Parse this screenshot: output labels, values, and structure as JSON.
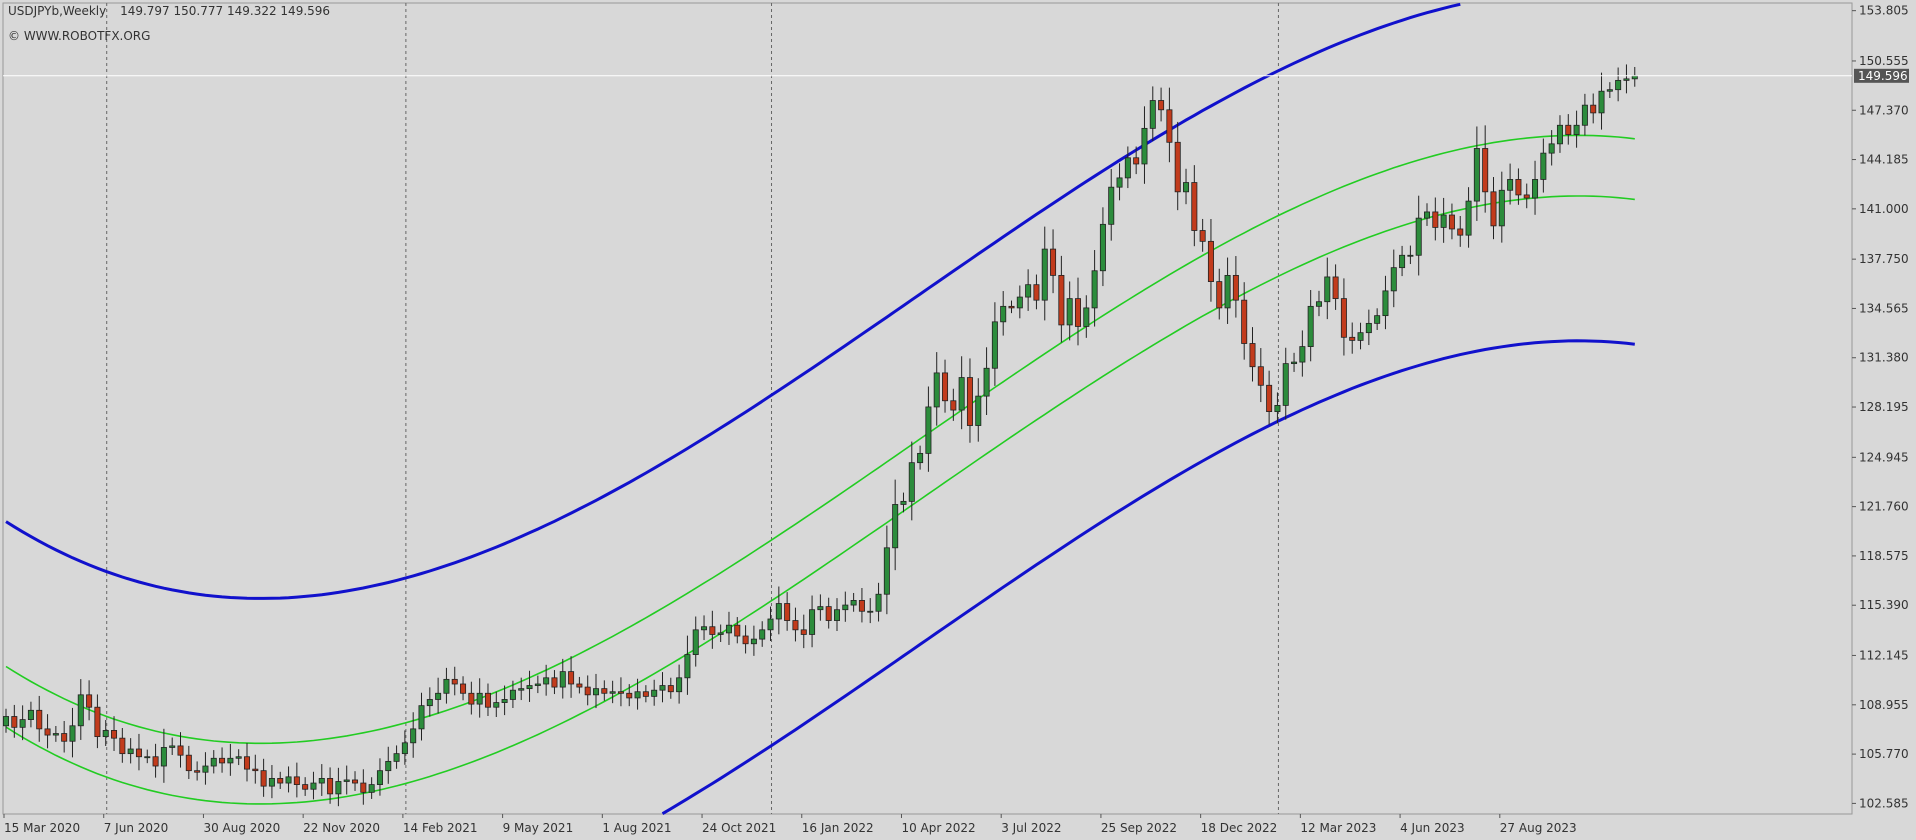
{
  "header": {
    "symbol": "USDJPYb,Weekly",
    "open": "149.797",
    "high": "150.777",
    "low": "149.322",
    "close": "149.596"
  },
  "credit": "© WWW.ROBOTFX.ORG",
  "current_price_label": "149.596",
  "chart_data": {
    "type": "candlestick",
    "timeframe": "Weekly",
    "x_labels": [
      "15 Mar 2020",
      "7 Jun 2020",
      "30 Aug 2020",
      "22 Nov 2020",
      "14 Feb 2021",
      "9 May 2021",
      "1 Aug 2021",
      "24 Oct 2021",
      "16 Jan 2022",
      "10 Apr 2022",
      "3 Jul 2022",
      "25 Sep 2022",
      "18 Dec 2022",
      "12 Mar 2023",
      "4 Jun 2023",
      "27 Aug 2023"
    ],
    "y_ticks": [
      "153.805",
      "150.555",
      "147.370",
      "144.185",
      "141.000",
      "137.750",
      "134.565",
      "131.380",
      "128.195",
      "124.945",
      "121.760",
      "118.575",
      "115.390",
      "112.145",
      "108.955",
      "105.770",
      "102.585"
    ],
    "ylim": [
      101.9,
      154.3
    ],
    "current_price": 149.596,
    "separator_after_weeks": [
      12,
      48,
      92,
      153
    ],
    "closes": [
      108.2,
      107.5,
      108.0,
      108.6,
      107.4,
      107.0,
      107.1,
      106.6,
      107.6,
      109.6,
      108.8,
      106.9,
      107.3,
      106.8,
      105.8,
      106.1,
      105.6,
      105.6,
      105.0,
      106.2,
      106.3,
      105.7,
      104.7,
      104.6,
      105.0,
      105.5,
      105.2,
      105.5,
      105.6,
      104.8,
      104.7,
      103.7,
      104.2,
      103.9,
      104.3,
      103.8,
      103.5,
      103.9,
      104.2,
      103.2,
      104.0,
      104.1,
      103.9,
      103.3,
      103.8,
      104.7,
      105.3,
      105.8,
      106.5,
      107.4,
      108.9,
      109.3,
      109.7,
      110.6,
      110.3,
      109.7,
      109.0,
      109.7,
      108.8,
      109.1,
      109.3,
      109.9,
      110.0,
      110.2,
      110.3,
      110.7,
      110.1,
      111.1,
      110.3,
      110.1,
      109.6,
      110.0,
      109.7,
      109.8,
      109.7,
      109.4,
      109.8,
      109.5,
      109.9,
      110.2,
      109.8,
      110.7,
      112.2,
      113.8,
      114.0,
      113.5,
      113.6,
      114.1,
      113.4,
      112.9,
      113.2,
      113.8,
      114.5,
      115.5,
      114.4,
      113.8,
      113.5,
      115.1,
      115.3,
      114.4,
      115.1,
      115.4,
      115.7,
      115.0,
      115.0,
      116.1,
      119.1,
      121.9,
      122.1,
      124.6,
      125.2,
      128.2,
      130.4,
      128.6,
      128.0,
      130.1,
      127.0,
      128.9,
      130.7,
      133.7,
      134.7,
      134.6,
      135.3,
      136.1,
      135.1,
      138.4,
      136.7,
      133.5,
      135.2,
      133.4,
      134.6,
      137.0,
      140.0,
      142.4,
      143.0,
      144.3,
      143.9,
      146.2,
      148.0,
      147.4,
      145.3,
      142.1,
      142.7,
      139.6,
      138.9,
      136.3,
      134.6,
      136.7,
      135.1,
      132.3,
      130.8,
      129.6,
      127.9,
      128.3,
      131.0,
      131.1,
      132.1,
      134.7,
      135.0,
      136.6,
      135.2,
      132.7,
      132.5,
      133.0,
      133.6,
      134.1,
      135.7,
      137.2,
      138.0,
      138.0,
      140.4,
      140.8,
      139.8,
      140.6,
      139.7,
      139.3,
      141.5,
      144.9,
      142.1,
      139.9,
      142.2,
      142.9,
      141.9,
      141.7,
      142.9,
      144.6,
      145.2,
      146.4,
      145.8,
      146.4,
      147.7,
      147.2,
      148.6,
      148.7,
      149.3,
      149.4,
      149.6
    ]
  },
  "colors": {
    "background": "#d8d8d8",
    "bull_candle": "#2c8c3c",
    "bear_candle": "#c23b1c",
    "wick": "#222222",
    "outer_band": "#1111cc",
    "inner_band": "#22cc22",
    "grid_separator": "#666666",
    "price_line": "#ffffff",
    "price_label_bg": "#555555"
  }
}
